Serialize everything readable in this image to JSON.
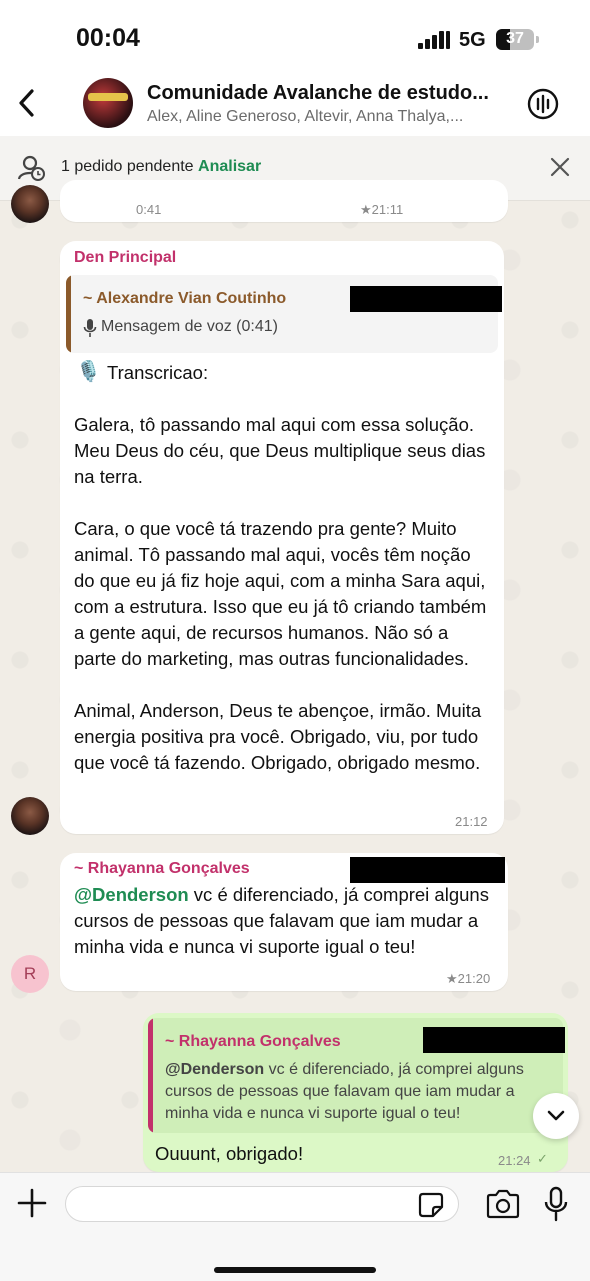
{
  "status_bar": {
    "time": "00:04",
    "network": "5G",
    "battery": "37",
    "battery_level": 0.37
  },
  "header": {
    "title": "Comunidade Avalanche de estudo...",
    "members": "Alex, Aline Generoso, Altevir, Anna Thalya,..."
  },
  "pending": {
    "text": "1 pedido pendente",
    "link": "Analisar"
  },
  "messages": {
    "prev": {
      "duration": "0:41",
      "time": "★21:11"
    },
    "den": {
      "sender": "Den Principal",
      "quote_author": "~ Alexandre Vian Coutinho",
      "quote_text": "Mensagem de voz (0:41)",
      "transcript_label": "Transcricao:",
      "body": "Galera, tô passando mal aqui com essa solução. Meu Deus do céu, que Deus multiplique seus dias na terra.\n\nCara, o que você tá trazendo pra gente? Muito animal. Tô passando mal aqui, vocês têm noção do que eu já fiz hoje aqui, com a minha Sara aqui, com a estrutura. Isso que eu já tô criando também a gente aqui, de recursos humanos. Não só a parte do marketing, mas outras funcionalidades.\n\nAnimal, Anderson, Deus te abençoe, irmão. Muita energia positiva pra você. Obrigado, viu, por tudo que você tá fazendo. Obrigado, obrigado mesmo.",
      "time": "21:12"
    },
    "rhayanna": {
      "avatar_letter": "R",
      "sender": "~ Rhayanna Gonçalves",
      "mention": "@Denderson",
      "body": " vc é diferenciado, já comprei alguns cursos de pessoas que falavam que iam mudar a minha vida e nunca vi suporte igual o teu!",
      "time": "★21:20"
    },
    "reply": {
      "quote_author": "~ Rhayanna Gonçalves",
      "quote_mention": "@Denderson",
      "quote_text": " vc é diferenciado, já comprei alguns cursos de pessoas que falavam que iam mudar a minha vida e nunca vi suporte igual o teu!",
      "body": "Ouuunt, obrigado!",
      "time": "21:24",
      "check": "✓"
    }
  },
  "colors": {
    "sender_pink": "#c2316b",
    "mention_green": "#1f8c53",
    "outgoing_bubble": "#dcf8c6",
    "quote_bar_brown": "#8b5a2b"
  },
  "icons": [
    "back-icon",
    "call-icon",
    "pending-user-icon",
    "close-icon",
    "microphone-emoji-icon",
    "voice-mic-icon",
    "chevron-down-icon",
    "plus-icon",
    "sticker-icon",
    "camera-icon",
    "mic-icon"
  ]
}
